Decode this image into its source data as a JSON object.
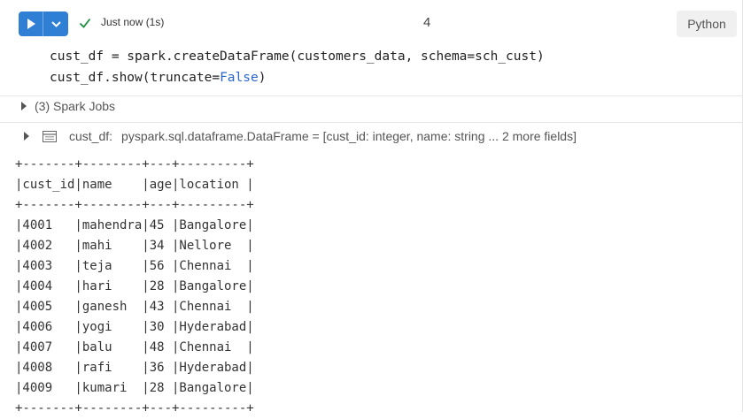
{
  "toolbar": {
    "run_icon": "play-icon",
    "menu_icon": "chevron-down-icon",
    "status_icon": "check-icon",
    "status_text": "Just now (1s)",
    "cell_number": "4",
    "language": "Python",
    "accent_color": "#2f7fd5",
    "success_color": "#1e8e3e"
  },
  "code": {
    "line1": {
      "a": "cust_df = spark.createDataFrame(customers_data, schema=sch_cust)"
    },
    "line2": {
      "a": "cust_df.show(truncate=",
      "b": "False",
      "c": ")"
    }
  },
  "jobs": {
    "label": "(3) Spark Jobs"
  },
  "dataframe": {
    "icon": "table-icon",
    "name": "cust_df:",
    "type": "pyspark.sql.dataframe.DataFrame = [cust_id: integer, name: string ... 2 more fields]"
  },
  "output": {
    "border": "+-------+--------+---+---------+",
    "header": "|cust_id|name    |age|location |",
    "rows": [
      "|4001   |mahendra|45 |Bangalore|",
      "|4002   |mahi    |34 |Nellore  |",
      "|4003   |teja    |56 |Chennai  |",
      "|4004   |hari    |28 |Bangalore|",
      "|4005   |ganesh  |43 |Chennai  |",
      "|4006   |yogi    |30 |Hyderabad|",
      "|4007   |balu    |48 |Chennai  |",
      "|4008   |rafi    |36 |Hyderabad|",
      "|4009   |kumari  |28 |Bangalore|"
    ]
  }
}
